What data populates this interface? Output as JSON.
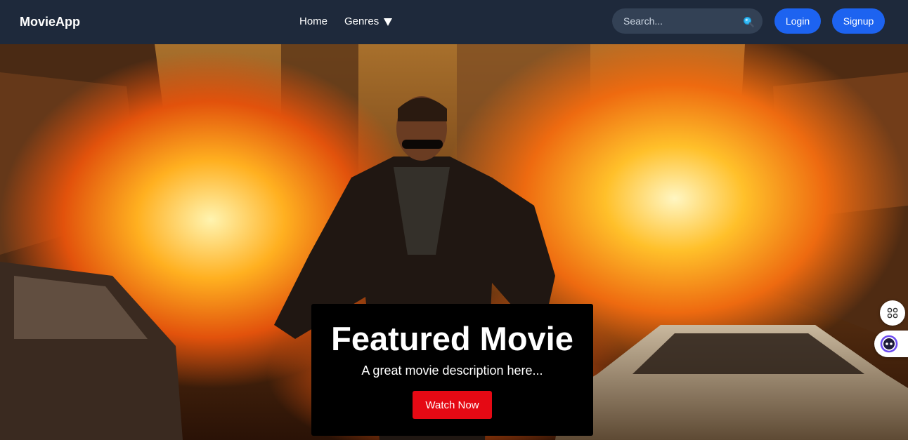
{
  "navbar": {
    "brand": "MovieApp",
    "links": [
      {
        "label": "Home"
      },
      {
        "label": "Genres"
      }
    ],
    "search": {
      "placeholder": "Search...",
      "value": ""
    },
    "login_label": "Login",
    "signup_label": "Signup"
  },
  "hero": {
    "background": "action-movie-explosion-image",
    "featured": {
      "title": "Featured Movie",
      "description": "A great movie description here...",
      "button_label": "Watch Now"
    }
  },
  "widgets": {
    "apps_icon": "apps-grid-icon",
    "assistant_icon": "assistant-bot-icon"
  },
  "colors": {
    "navbar_bg": "#1e293b",
    "search_bg": "#334155",
    "primary_button": "#1d63f0",
    "watch_button": "#e50914",
    "card_bg": "#000000"
  }
}
